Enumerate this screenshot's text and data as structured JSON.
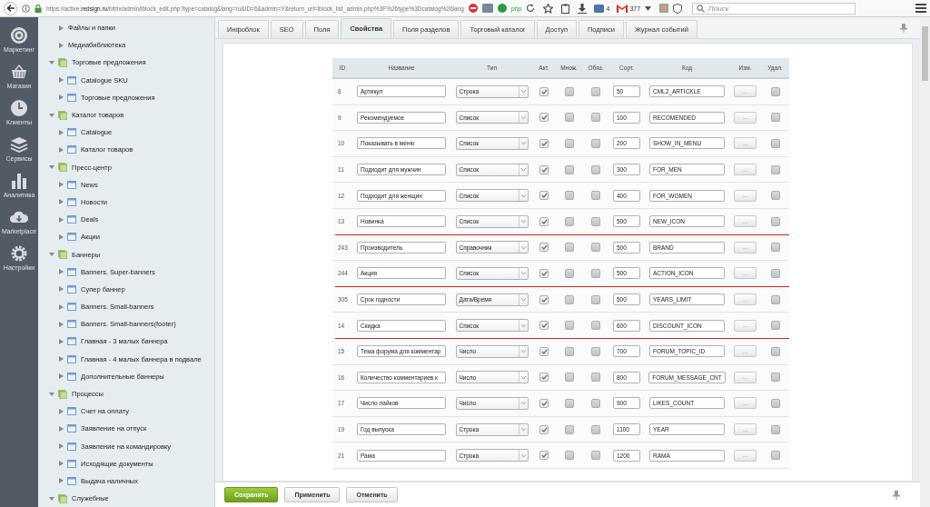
{
  "browser": {
    "url_prefix": "https://active.",
    "url_domain": "redsign.ru",
    "url_rest": "/bitrix/admin/iblock_edit.php?type=catalog&lang=ru&ID=6&admin=Y&return_url=iblock_list_admin.php%3F%26type%3Dcatalog%26lang",
    "extension_badge": "php",
    "downloads_count": "4",
    "mail_count": "377",
    "search": {
      "placeholder": "Поиск"
    }
  },
  "nav": [
    {
      "label": "Маркетинг",
      "kind": "target"
    },
    {
      "label": "Магазин",
      "kind": "basket"
    },
    {
      "label": "Клиенты",
      "kind": "clock"
    },
    {
      "label": "Сервисы",
      "kind": "layers"
    },
    {
      "label": "Аналитика",
      "kind": "bars"
    },
    {
      "label": "Marketplace",
      "kind": "cloud"
    },
    {
      "label": "Настройки",
      "kind": "gear"
    }
  ],
  "tree": [
    {
      "label": "Файлы и папки",
      "kind": "page"
    },
    {
      "label": "Медиабиблиотека",
      "kind": "page"
    },
    {
      "label": "Торговые предложения",
      "kind": "section",
      "expanded": true,
      "children": [
        {
          "label": "Catalogue SKU"
        },
        {
          "label": "Торговые предложения"
        }
      ]
    },
    {
      "label": "Каталог товаров",
      "kind": "section",
      "expanded": true,
      "children": [
        {
          "label": "Catalogue"
        },
        {
          "label": "Каталог товаров"
        }
      ]
    },
    {
      "label": "Пресс-центр",
      "kind": "section",
      "expanded": true,
      "children": [
        {
          "label": "News"
        },
        {
          "label": "Новости"
        },
        {
          "label": "Deals"
        },
        {
          "label": "Акции"
        }
      ]
    },
    {
      "label": "Баннеры",
      "kind": "section",
      "expanded": true,
      "children": [
        {
          "label": "Banners. Super-banners"
        },
        {
          "label": "Супер баннер"
        },
        {
          "label": "Banners. Small-banners"
        },
        {
          "label": "Banners. Small-banners(footer)"
        },
        {
          "label": "Главная - 3 малых баннера"
        },
        {
          "label": "Главная - 4 малых баннера в подвале"
        },
        {
          "label": "Дополнительные баннеры"
        }
      ]
    },
    {
      "label": "Процессы",
      "kind": "section",
      "expanded": true,
      "children": [
        {
          "label": "Счет на оплату"
        },
        {
          "label": "Заявление на отпуск"
        },
        {
          "label": "Заявление на командировку"
        },
        {
          "label": "Исходящие документы"
        },
        {
          "label": "Выдача наличных"
        }
      ]
    },
    {
      "label": "Служебные",
      "kind": "section",
      "expanded": true
    }
  ],
  "tabs": [
    {
      "label": "Инфоблок",
      "selected": false
    },
    {
      "label": "SEO",
      "selected": false
    },
    {
      "label": "Поля",
      "selected": false
    },
    {
      "label": "Свойства",
      "selected": true
    },
    {
      "label": "Поля разделов",
      "selected": false
    },
    {
      "label": "Торговый каталог",
      "selected": false
    },
    {
      "label": "Доступ",
      "selected": false
    },
    {
      "label": "Подписи",
      "selected": false
    },
    {
      "label": "Журнал событий",
      "selected": false
    }
  ],
  "table": {
    "columns": [
      "ID",
      "Название",
      "Тип",
      "Акт.",
      "Множ.",
      "Обяз.",
      "Сорт.",
      "Код",
      "Изм.",
      "Удал."
    ],
    "rows": [
      {
        "id": "8",
        "name": "Артикул",
        "type": "Строка",
        "active": true,
        "multiple": false,
        "required": false,
        "sort": "50",
        "code": "CML2_ARTICKLE",
        "edit": "...",
        "delete": false,
        "underlined": false
      },
      {
        "id": "9",
        "name": "Рекомендуемое",
        "type": "Список",
        "active": true,
        "multiple": false,
        "required": false,
        "sort": "100",
        "code": "RECOMENDED",
        "edit": "...",
        "delete": false,
        "underlined": false
      },
      {
        "id": "10",
        "name": "Показывать в меню",
        "type": "Список",
        "active": true,
        "multiple": false,
        "required": false,
        "sort": "200",
        "code": "SHOW_IN_MENU",
        "edit": "...",
        "delete": false,
        "underlined": false
      },
      {
        "id": "11",
        "name": "Подходит для мужчин",
        "type": "Список",
        "active": true,
        "multiple": false,
        "required": false,
        "sort": "300",
        "code": "FOR_MEN",
        "edit": "...",
        "delete": false,
        "underlined": false
      },
      {
        "id": "12",
        "name": "Подходит для женщин",
        "type": "Список",
        "active": true,
        "multiple": false,
        "required": false,
        "sort": "400",
        "code": "FOR_WOMEN",
        "edit": "...",
        "delete": false,
        "underlined": false
      },
      {
        "id": "13",
        "name": "Новинка",
        "type": "Список",
        "active": true,
        "multiple": false,
        "required": false,
        "sort": "500",
        "code": "NEW_ICON",
        "edit": "...",
        "delete": false,
        "underlined": true
      },
      {
        "id": "243",
        "name": "Производитель",
        "type": "Справочник",
        "active": true,
        "multiple": false,
        "required": false,
        "sort": "500",
        "code": "BRAND",
        "edit": "...",
        "delete": false,
        "underlined": false
      },
      {
        "id": "244",
        "name": "Акция",
        "type": "Список",
        "active": true,
        "multiple": false,
        "required": false,
        "sort": "500",
        "code": "ACTION_ICON",
        "edit": "...",
        "delete": false,
        "underlined": true
      },
      {
        "id": "305",
        "name": "Срок годности",
        "type": "Дата/Время",
        "active": true,
        "multiple": false,
        "required": false,
        "sort": "500",
        "code": "YEARS_LIMIT",
        "edit": "...",
        "delete": false,
        "underlined": false
      },
      {
        "id": "14",
        "name": "Скидка",
        "type": "Список",
        "active": true,
        "multiple": false,
        "required": false,
        "sort": "600",
        "code": "DISCOUNT_ICON",
        "edit": "...",
        "delete": false,
        "underlined": true
      },
      {
        "id": "15",
        "name": "Тема форума для комментар",
        "type": "Число",
        "active": true,
        "multiple": false,
        "required": false,
        "sort": "700",
        "code": "FORUM_TOPIC_ID",
        "edit": "...",
        "delete": false,
        "underlined": false
      },
      {
        "id": "16",
        "name": "Количество комментариев к",
        "type": "Число",
        "active": true,
        "multiple": false,
        "required": false,
        "sort": "800",
        "code": "FORUM_MESSAGE_CNT",
        "edit": "...",
        "delete": false,
        "underlined": false
      },
      {
        "id": "17",
        "name": "Число лайков",
        "type": "Число",
        "active": true,
        "multiple": false,
        "required": false,
        "sort": "900",
        "code": "LIKES_COUNT",
        "edit": "...",
        "delete": false,
        "underlined": false
      },
      {
        "id": "19",
        "name": "Год выпуска",
        "type": "Строка",
        "active": true,
        "multiple": false,
        "required": false,
        "sort": "1100",
        "code": "YEAR",
        "edit": "...",
        "delete": false,
        "underlined": false
      },
      {
        "id": "21",
        "name": "Рама",
        "type": "Строка",
        "active": true,
        "multiple": false,
        "required": false,
        "sort": "1200",
        "code": "RAMA",
        "edit": "...",
        "delete": false,
        "underlined": false
      }
    ]
  },
  "buttons": [
    {
      "label": "Сохранить",
      "kind": "primary"
    },
    {
      "label": "Применить",
      "kind": "plain"
    },
    {
      "label": "Отменить",
      "kind": "plain"
    }
  ]
}
